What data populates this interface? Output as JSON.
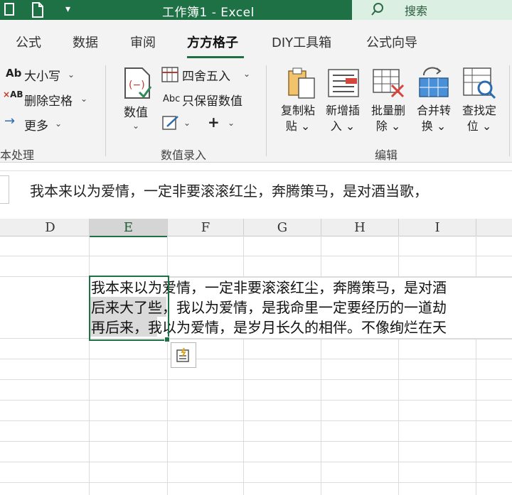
{
  "titlebar": {
    "title": "工作簿1  -  Excel",
    "search_label": "搜索",
    "brand_color": "#1e7145"
  },
  "tabs": [
    {
      "label": "公式"
    },
    {
      "label": "数据"
    },
    {
      "label": "审阅"
    },
    {
      "label": "方方格子",
      "active": true
    },
    {
      "label": "DIY工具箱"
    },
    {
      "label": "公式向导"
    }
  ],
  "ribbon": {
    "text_group": {
      "case_label": "大小写",
      "trim_label": "删除空格",
      "more_label": "更多",
      "group_label": "本处理"
    },
    "data_entry": {
      "numeric_label": "数值",
      "round_label": "四舍五入",
      "keep_values_label": "只保留数值",
      "plus_label": "+",
      "group_label": "数值录入"
    },
    "edit": {
      "copy_paste_label_1": "复制粘",
      "copy_paste_label_2": "贴",
      "insert_label_1": "新增插",
      "insert_label_2": "入",
      "batch_delete_label_1": "批量删",
      "batch_delete_label_2": "除",
      "merge_label_1": "合并转",
      "merge_label_2": "换",
      "find_label_1": "查找定",
      "find_label_2": "位",
      "group_label": "编辑"
    }
  },
  "formula_bar": {
    "content": "我本来以为爱情，一定非要滚滚红尘，奔腾策马，是对酒当歌，"
  },
  "grid": {
    "columns": [
      "D",
      "E",
      "F",
      "G",
      "H",
      "I"
    ],
    "selected_column": "E",
    "cell_lines": [
      "我本来以为爱情，一定非要滚滚红尘，奔腾策马，是对酒",
      "后来大了些，我以为爱情，是我命里一定要经历的一道劫",
      "再后来，我以为爱情，是岁月长久的相伴。不像绚烂在天"
    ]
  }
}
